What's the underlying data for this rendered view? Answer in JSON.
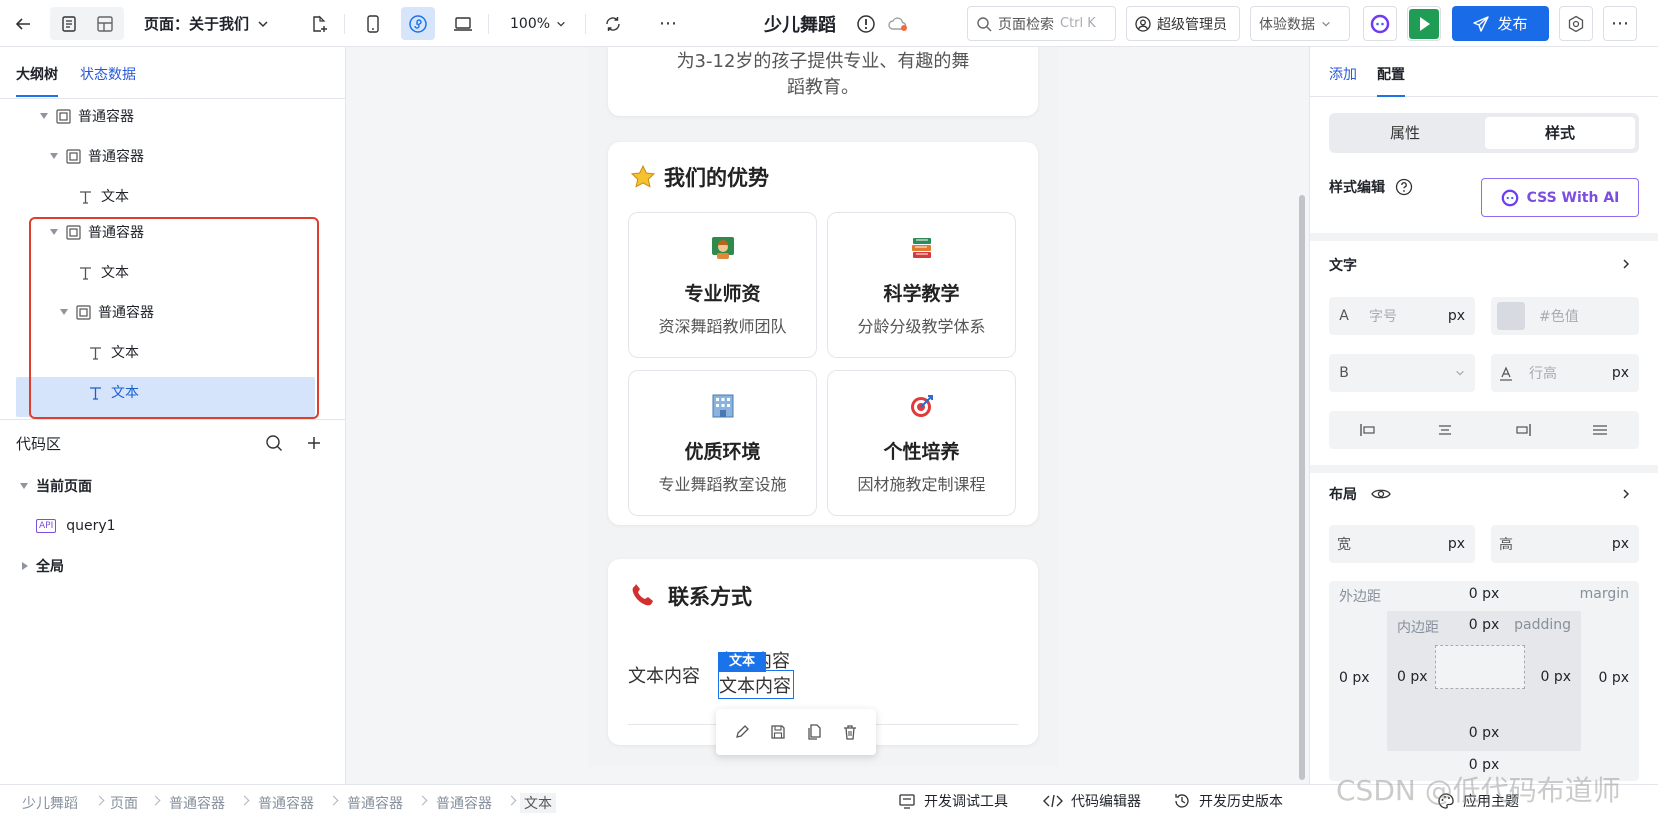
{
  "topbar": {
    "page_label": "页面：关于我们",
    "zoom": "100%",
    "app_name": "少儿舞蹈",
    "search_placeholder": "页面检索",
    "search_shortcut": "Ctrl K",
    "admin_label": "超级管理员",
    "data_select": "体验数据",
    "publish_label": "发布"
  },
  "left": {
    "tabs": [
      "大纲树",
      "状态数据"
    ],
    "tree": [
      {
        "label": "普通容器",
        "type": "container"
      },
      {
        "label": "普通容器",
        "type": "container"
      },
      {
        "label": "文本",
        "type": "text"
      },
      {
        "label": "普通容器",
        "type": "container"
      },
      {
        "label": "文本",
        "type": "text"
      },
      {
        "label": "普通容器",
        "type": "container"
      },
      {
        "label": "文本",
        "type": "text"
      },
      {
        "label": "文本",
        "type": "text"
      }
    ],
    "code_title": "代码区",
    "current_page": "当前页面",
    "api_badge": "API",
    "query": "query1",
    "global": "全局"
  },
  "canvas": {
    "intro_line1": "为3-12岁的孩子提供专业、有趣的舞",
    "intro_line2": "蹈教育。",
    "advantages_title": "我们的优势",
    "features": [
      {
        "title": "专业师资",
        "desc": "资深舞蹈教师团队",
        "icon": "teacher-icon"
      },
      {
        "title": "科学教学",
        "desc": "分龄分级教学体系",
        "icon": "books-icon"
      },
      {
        "title": "优质环境",
        "desc": "专业舞蹈教室设施",
        "icon": "building-icon"
      },
      {
        "title": "个性培养",
        "desc": "因材施教定制课程",
        "icon": "target-icon"
      }
    ],
    "contact_title": "联系方式",
    "text_a": "文本内容",
    "text_b": "文本内容",
    "text_c": "文本内容",
    "selection_tag": "文本"
  },
  "right": {
    "tabs": [
      "添加",
      "配置"
    ],
    "seg": [
      "属性",
      "样式"
    ],
    "style_edit": "样式编辑",
    "css_ai": "CSS With AI",
    "text_section": "文字",
    "font_a": "A",
    "font_size_ph": "字号",
    "px": "px",
    "color_ph": "#色值",
    "bold_b": "B",
    "line_height_ph": "行高",
    "layout_section": "布局",
    "width_label": "宽",
    "height_label": "高",
    "margin_label": "外边距",
    "margin_en": "margin",
    "padding_label": "内边距",
    "padding_en": "padding",
    "zero_px": "0 px"
  },
  "bottom": {
    "breadcrumb": [
      "少儿舞蹈",
      "页面",
      "普通容器",
      "普通容器",
      "普通容器",
      "普通容器",
      "文本"
    ],
    "debug": "开发调试工具",
    "code_editor": "代码编辑器",
    "history": "开发历史版本",
    "apply_theme": "应用主题",
    "watermark": "CSDN @低代码布道师"
  },
  "colors": {
    "primary": "#1a73e8",
    "selection_border": "#e03e2d",
    "selected_row": "#d6e4fb",
    "play_green": "#1f9d55"
  }
}
